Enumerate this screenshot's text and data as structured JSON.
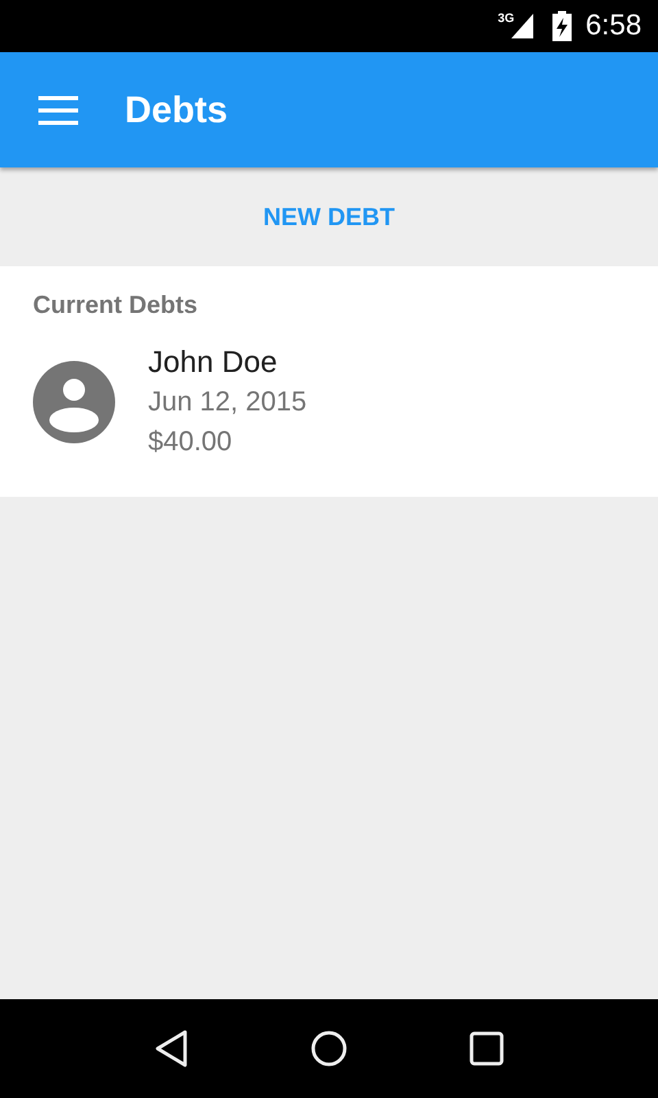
{
  "status_bar": {
    "network": "3G",
    "time": "6:58"
  },
  "app_bar": {
    "title": "Debts"
  },
  "action": {
    "label": "NEW DEBT"
  },
  "section": {
    "title": "Current Debts",
    "items": [
      {
        "name": "John Doe",
        "date": "Jun 12, 2015",
        "amount": "$40.00"
      }
    ]
  }
}
